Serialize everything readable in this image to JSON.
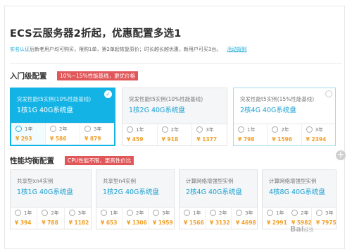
{
  "header": {
    "title": "ECS云服务器2折起，优惠配置多选1",
    "notice_prefix": "实名认证",
    "notice_body": "后新老用户均可购买，限购1单，第2单起恢复原价；时长越长越优惠，新用户可买3台。",
    "notice_link": "活动规则"
  },
  "sections": [
    {
      "title": "入门级配置",
      "tag": "10%~15%性能基线，更优价格",
      "cards": [
        {
          "subtitle": "突发性能t5实例(10%性能基线)",
          "spec": "1核1G 40G系统盘",
          "state": "selected",
          "options": [
            {
              "term": "1年",
              "price": "¥ 293"
            },
            {
              "term": "2年",
              "price": "¥ 586"
            },
            {
              "term": "3年",
              "price": "¥ 879"
            }
          ]
        },
        {
          "subtitle": "突发性能t5实例(10%性能基线)",
          "spec": "1核2G 40G系统盘",
          "state": "normal",
          "options": [
            {
              "term": "1年",
              "price": "¥ 459"
            },
            {
              "term": "2年",
              "price": "¥ 918"
            },
            {
              "term": "3年",
              "price": "¥ 1377"
            }
          ]
        },
        {
          "subtitle": "突发性能t5实例(15%性能基线)",
          "spec": "2核4G 40G系统盘",
          "state": "hover",
          "options": [
            {
              "term": "1年",
              "price": "¥ 798"
            },
            {
              "term": "2年",
              "price": "¥ 1596"
            },
            {
              "term": "3年",
              "price": "¥ 2394"
            }
          ]
        }
      ]
    },
    {
      "title": "性能均衡配置",
      "tag": "CPU性能不限，更高性价比",
      "cards": [
        {
          "subtitle": "共享型xn4实例",
          "spec": "1核1G 40G系统盘",
          "state": "normal",
          "options": [
            {
              "term": "1年",
              "price": "¥ 394"
            },
            {
              "term": "2年",
              "price": "¥ 788"
            },
            {
              "term": "3年",
              "price": "¥ 1182"
            }
          ]
        },
        {
          "subtitle": "共享型n4实例",
          "spec": "1核2G 40G系统盘",
          "state": "normal",
          "options": [
            {
              "term": "1年",
              "price": "¥ 653"
            },
            {
              "term": "2年",
              "price": "¥ 1306"
            },
            {
              "term": "3年",
              "price": "¥ 1959"
            }
          ]
        },
        {
          "subtitle": "计算网络增强型实例",
          "spec": "2核4G 40G系统盘",
          "state": "normal",
          "options": [
            {
              "term": "1年",
              "price": "¥ 1566"
            },
            {
              "term": "2年",
              "price": "¥ 3132"
            },
            {
              "term": "3年",
              "price": "¥ 4698"
            }
          ]
        },
        {
          "subtitle": "计算网络增强型实例",
          "spec": "4核8G 40G系统盘",
          "state": "normal",
          "options": [
            {
              "term": "1年",
              "price": "¥ 2991"
            },
            {
              "term": "2年",
              "price": "¥ 5982"
            },
            {
              "term": "3年",
              "price": "¥ 7975"
            }
          ]
        }
      ]
    }
  ],
  "watermark": {
    "brand": "Bai",
    "suffix": "经验"
  },
  "icons": {
    "selected": "check-icon",
    "expand": "plus-icon"
  },
  "colors": {
    "accent": "#13b3e5",
    "price": "#f0a02a",
    "tag": "#e15759"
  }
}
